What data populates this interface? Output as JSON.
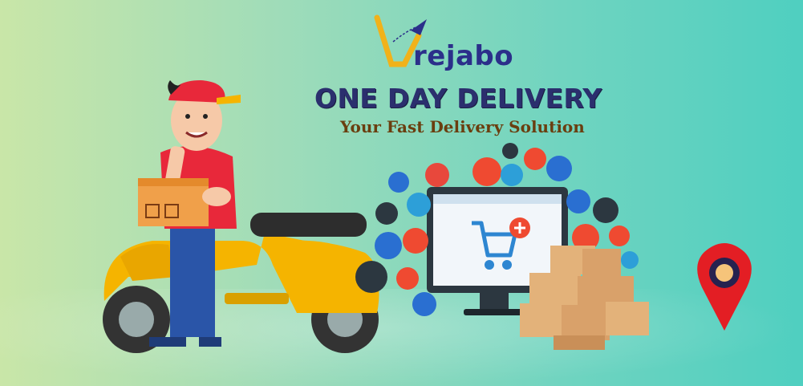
{
  "brand": {
    "name": "rejabo",
    "headline": "ONE DAY DELIVERY",
    "tagline": "Your Fast Delivery Solution",
    "logo_icon": "paper-plane-v-icon"
  },
  "colors": {
    "navy": "#2b2f6e",
    "brown": "#6a3e0f",
    "scooter_yellow": "#f5b400",
    "cap_red": "#e8283a",
    "pin_red": "#e31e24",
    "box_tan": "#e3b27a"
  },
  "illustration": {
    "person": "delivery-man",
    "vehicle": "scooter",
    "device": "monitor-with-cart",
    "marker": "map-pin",
    "floating_icons": [
      "search-icon",
      "chat-icon",
      "card-icon",
      "mail-icon",
      "globe-icon",
      "user-icon",
      "basket-icon",
      "thumbs-up-icon",
      "euro-icon",
      "cart-icon",
      "tag-icon",
      "dollar-icon",
      "gear-icon",
      "bag-icon",
      "presentation-icon"
    ]
  }
}
